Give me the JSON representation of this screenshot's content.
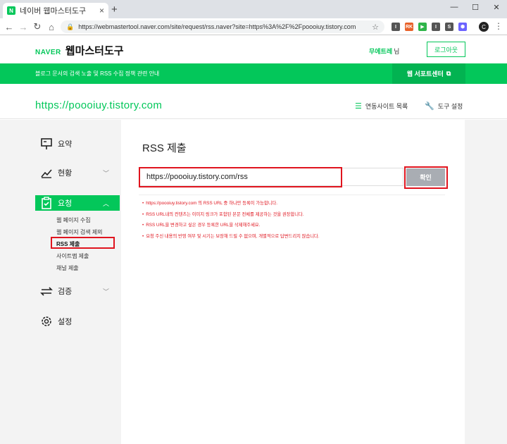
{
  "browser": {
    "tab_title": "네이버 웹마스터도구",
    "tab_close": "×",
    "new_tab": "+",
    "win_min": "—",
    "win_max": "☐",
    "win_close": "✕",
    "url": "https://webmastertool.naver.com/site/request/rss.naver?site=https%3A%2F%2Fpoooiuy.tistory.com",
    "avatar_letter": "C",
    "extensions": [
      {
        "label": "I",
        "color": "#555555"
      },
      {
        "label": "RK",
        "color": "#e8622a"
      },
      {
        "label": "▶",
        "color": "#2fb54a"
      },
      {
        "label": "I",
        "color": "#555555"
      },
      {
        "label": "S",
        "color": "#555555"
      },
      {
        "label": "⬢",
        "color": "#6c63ff"
      }
    ]
  },
  "header": {
    "brand": "NAVER",
    "service": "웹마스터도구",
    "username": "무에트레",
    "honorific": "님",
    "logout": "로그아웃"
  },
  "banner": {
    "message": "블로그 문서의 검색 노출 및 RSS 수집 정책 관련 안내",
    "support": "웹 서포트센터"
  },
  "sitebar": {
    "site_url": "https://poooiuy.tistory.com",
    "site_list": "연동사이트 목록",
    "tool_settings": "도구 설정"
  },
  "sidebar": {
    "summary": "요약",
    "status": "현황",
    "request": "요청",
    "request_sub": [
      "웹 페이지 수집",
      "웹 페이지 검색 제외",
      "RSS 제출",
      "사이트맵 제출",
      "채널 제출"
    ],
    "verify": "검증",
    "settings": "설정"
  },
  "content": {
    "title": "RSS 제출",
    "rss_value": "https://poooiuy.tistory.com/rss",
    "confirm": "확인",
    "notes": [
      "https://poooiuy.tistory.com 의 RSS URL 중 하나만 등록이 가능합니다.",
      "RSS URL내의 컨텐츠는 이미지 링크가 포함된 본문 전체를 제공하는 것을 권장합니다.",
      "RSS URL을 변경하고 싶은 경우 등록한 URL을 삭제해주세요.",
      "요청 주신 내용의 반영 여부 및 시기는 보장해 드릴 수 없으며, 개별적으로 답변드리지 않습니다."
    ]
  },
  "colors": {
    "naver_green": "#03c75a",
    "highlight_red": "#e0141e",
    "button_gray": "#a9adb3"
  }
}
